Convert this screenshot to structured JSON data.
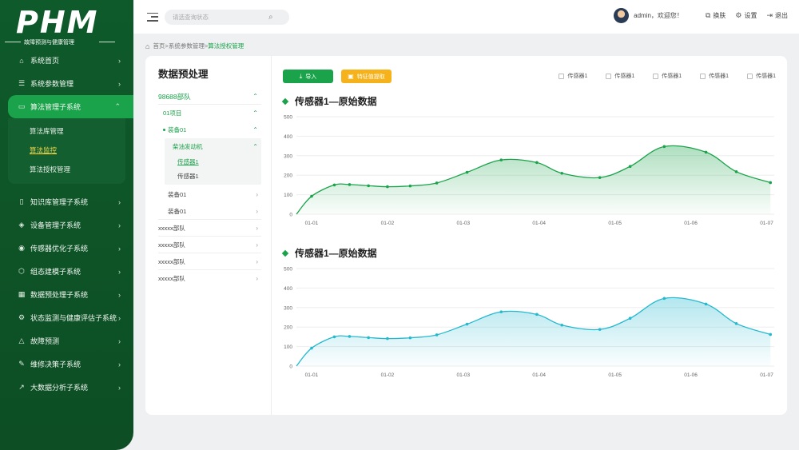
{
  "logo": {
    "title": "PHM",
    "subtitle": "故障预测与健康管理"
  },
  "sidebar": {
    "items": [
      {
        "label": "系统首页",
        "icon": "home-icon"
      },
      {
        "label": "系统参数管理",
        "icon": "sliders-icon"
      },
      {
        "label": "算法管理子系统",
        "icon": "monitor-icon",
        "active": true
      },
      {
        "label": "知识库管理子系统",
        "icon": "book-icon"
      },
      {
        "label": "设备管理子系统",
        "icon": "layers-icon"
      },
      {
        "label": "传感器优化子系统",
        "icon": "sensor-icon"
      },
      {
        "label": "组态建模子系统",
        "icon": "shield-icon"
      },
      {
        "label": "数据预处理子系统",
        "icon": "grid-icon"
      },
      {
        "label": "状态监测与健康评估子系统",
        "icon": "settings-icon"
      },
      {
        "label": "故障预测",
        "icon": "alert-icon"
      },
      {
        "label": "维修决策子系统",
        "icon": "wrench-icon"
      },
      {
        "label": "大数据分析子系统",
        "icon": "trend-icon"
      }
    ],
    "submenu": [
      {
        "label": "算法库管理"
      },
      {
        "label": "算法监控",
        "current": true
      },
      {
        "label": "算法授权管理"
      }
    ]
  },
  "topbar": {
    "search_placeholder": "请选查询状态",
    "welcome": "admin，欢迎您！",
    "skin": "换肤",
    "settings": "设置",
    "logout": "退出"
  },
  "breadcrumb": {
    "parts": "首页>系统参数管理>",
    "current": "算法授权管理"
  },
  "tree": {
    "title": "数据预处理",
    "root": "98688部队",
    "project": "01项目",
    "equip_open": "装备01",
    "engine": "柴油发动机",
    "sensor_selected": "传感器1",
    "sensor_other": "传感器1",
    "equip2": "装备01",
    "equip3": "装备01",
    "units": [
      "xxxxx部队",
      "xxxxx部队",
      "xxxxx部队",
      "xxxxx部队"
    ]
  },
  "toolbar": {
    "import_label": "导入",
    "feature_label": "特征值提取",
    "checks": [
      "传感器1",
      "传感器1",
      "传感器1",
      "传感器1",
      "传感器1"
    ]
  },
  "colors": {
    "primary": "#1aa34a",
    "accent": "#f6b21b",
    "cyan": "#25b9cf"
  },
  "chart_data": [
    {
      "type": "area",
      "title": "传感器1—原始数据",
      "color": "#1aa34a",
      "x_ticks": [
        "01-01",
        "01-02",
        "01-03",
        "01-04",
        "01-05",
        "01-06",
        "01-07"
      ],
      "y_ticks": [
        0,
        100,
        200,
        300,
        400,
        500
      ],
      "ylim": [
        0,
        500
      ],
      "xlim": [
        0.8,
        7.1
      ],
      "points": [
        [
          0.8,
          0
        ],
        [
          1.0,
          92
        ],
        [
          1.3,
          150
        ],
        [
          1.5,
          152
        ],
        [
          1.75,
          146
        ],
        [
          2.0,
          141
        ],
        [
          2.3,
          145
        ],
        [
          2.65,
          160
        ],
        [
          3.05,
          215
        ],
        [
          3.5,
          278
        ],
        [
          3.97,
          265
        ],
        [
          4.3,
          210
        ],
        [
          4.8,
          188
        ],
        [
          5.2,
          245
        ],
        [
          5.65,
          347
        ],
        [
          6.2,
          318
        ],
        [
          6.6,
          218
        ],
        [
          7.05,
          162
        ]
      ]
    },
    {
      "type": "area",
      "title": "传感器1—原始数据",
      "color": "#25b9cf",
      "x_ticks": [
        "01-01",
        "01-02",
        "01-03",
        "01-04",
        "01-05",
        "01-06",
        "01-07"
      ],
      "y_ticks": [
        0,
        100,
        200,
        300,
        400,
        500
      ],
      "ylim": [
        0,
        500
      ],
      "xlim": [
        0.8,
        7.1
      ],
      "points": [
        [
          0.8,
          0
        ],
        [
          1.0,
          92
        ],
        [
          1.3,
          150
        ],
        [
          1.5,
          152
        ],
        [
          1.75,
          146
        ],
        [
          2.0,
          141
        ],
        [
          2.3,
          145
        ],
        [
          2.65,
          160
        ],
        [
          3.05,
          215
        ],
        [
          3.5,
          278
        ],
        [
          3.97,
          265
        ],
        [
          4.3,
          210
        ],
        [
          4.8,
          188
        ],
        [
          5.2,
          245
        ],
        [
          5.65,
          347
        ],
        [
          6.2,
          318
        ],
        [
          6.6,
          218
        ],
        [
          7.05,
          162
        ]
      ]
    }
  ]
}
